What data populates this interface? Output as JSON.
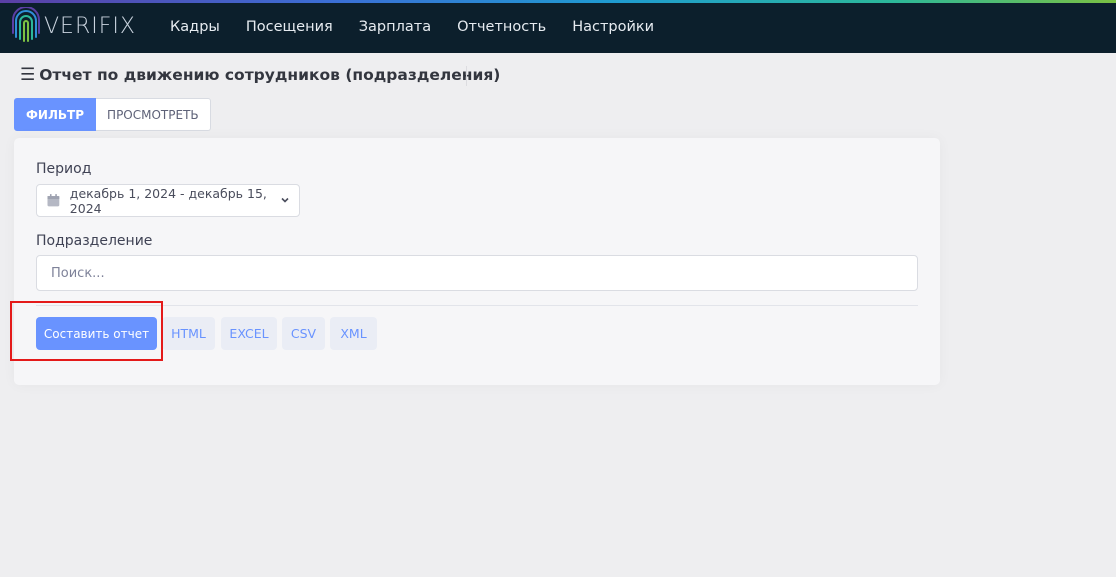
{
  "brand": {
    "name": "VERIFIX"
  },
  "nav": [
    "Кадры",
    "Посещения",
    "Зарплата",
    "Отчетность",
    "Настройки"
  ],
  "page": {
    "title": "Отчет по движению сотрудников (подразделения)",
    "menu_icon": "hamburger-icon"
  },
  "tabs": {
    "filter": "ФИЛЬТР",
    "view": "ПРОСМОТРЕТЬ"
  },
  "form": {
    "period_label": "Период",
    "period_value": "декабрь 1, 2024 - декабрь 15, 2024",
    "department_label": "Подразделение",
    "department_placeholder": "Поиск..."
  },
  "actions": {
    "generate": "Составить отчет",
    "html": "HTML",
    "excel": "EXCEL",
    "csv": "CSV",
    "xml": "XML"
  },
  "colors": {
    "accent": "#6993ff",
    "navbar": "#0c1f2c",
    "highlight": "#e41a1a"
  }
}
